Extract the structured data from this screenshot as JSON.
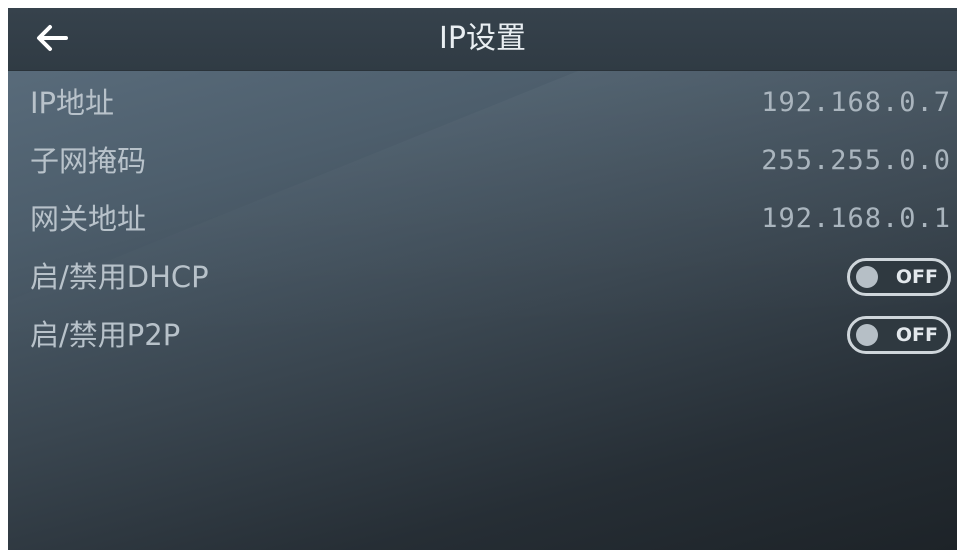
{
  "header": {
    "title": "IP设置",
    "back_icon": "arrow-left-icon"
  },
  "settings": {
    "ip_address": {
      "label": "IP地址",
      "value": "192.168.0.7"
    },
    "subnet_mask": {
      "label": "子网掩码",
      "value": "255.255.0.0"
    },
    "gateway": {
      "label": "网关地址",
      "value": "192.168.0.1"
    },
    "dhcp": {
      "label": "启/禁用DHCP",
      "state": "OFF"
    },
    "p2p": {
      "label": "启/禁用P2P",
      "state": "OFF"
    }
  }
}
